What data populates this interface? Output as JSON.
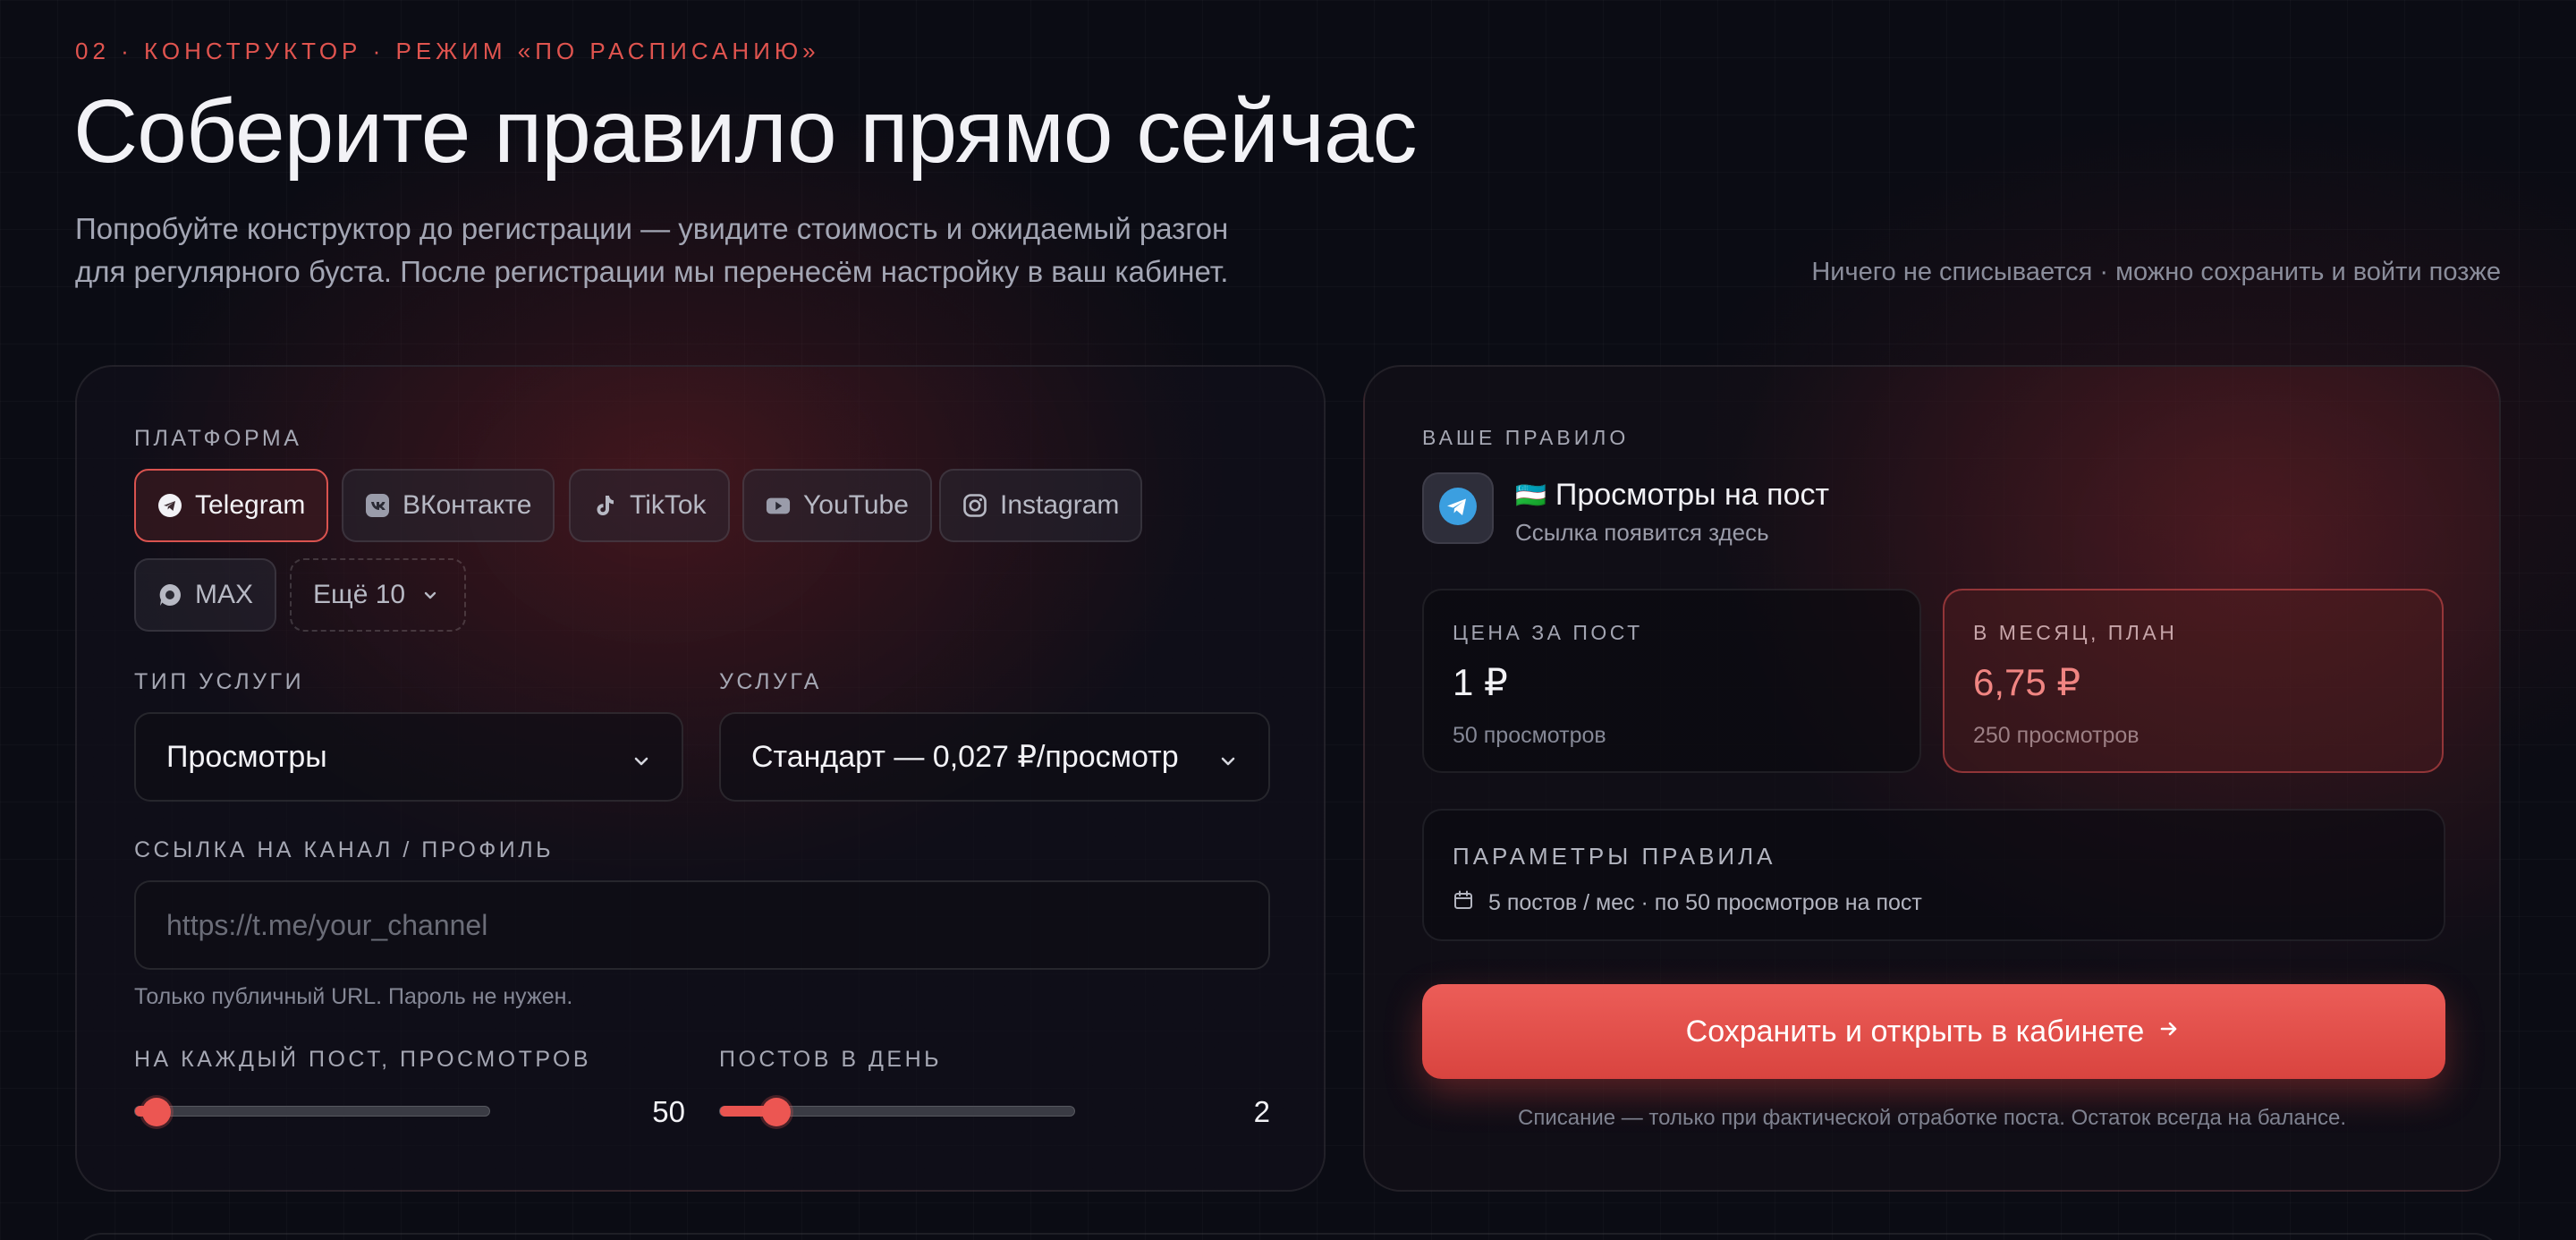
{
  "header": {
    "eyebrow": "02 · КОНСТРУКТОР · РЕЖИМ «ПО РАСПИСАНИЮ»",
    "title": "Соберите правило прямо сейчас",
    "lead_line1": "Попробуйте конструктор до регистрации — увидите стоимость и ожидаемый разгон",
    "lead_line2": "для регулярного буста. После регистрации мы перенесём настройку в ваш кабинет.",
    "note": "Ничего не списывается · можно сохранить и войти позже"
  },
  "builder": {
    "platform_label": "ПЛАТФОРМА",
    "platforms": [
      {
        "label": "Telegram",
        "icon": "telegram-icon",
        "active": true
      },
      {
        "label": "ВКонтакте",
        "icon": "vk-icon",
        "active": false
      },
      {
        "label": "TikTok",
        "icon": "tiktok-icon",
        "active": false
      },
      {
        "label": "YouTube",
        "icon": "youtube-icon",
        "active": false
      },
      {
        "label": "Instagram",
        "icon": "instagram-icon",
        "active": false
      },
      {
        "label": "MAX",
        "icon": "max-icon",
        "active": false
      }
    ],
    "more_label": "Ещё 10",
    "service_type_label": "ТИП УСЛУГИ",
    "service_type_value": "Просмотры",
    "service_label": "УСЛУГА",
    "service_value": "Стандарт — 0,027 ₽/просмотр",
    "link_label": "ССЫЛКА НА КАНАЛ / ПРОФИЛЬ",
    "link_value": "",
    "link_placeholder": "https://t.me/your_channel",
    "link_hint": "Только публичный URL. Пароль не нужен.",
    "per_post_label": "НА КАЖДЫЙ ПОСТ, ПРОСМОТРОВ",
    "per_post_value": "50",
    "per_post_fraction": 0.04,
    "posts_per_day_label": "ПОСТОВ В ДЕНЬ",
    "posts_per_day_value": "2",
    "posts_per_day_fraction": 0.14
  },
  "rule": {
    "label": "ВАШЕ ПРАВИЛО",
    "icon": "telegram-icon",
    "flag": "🇺🇿",
    "title": "Просмотры на пост",
    "subtitle": "Ссылка появится здесь",
    "price_label": "ЦЕНА ЗА ПОСТ",
    "price_value": "1 ₽",
    "price_sub": "50 просмотров",
    "month_label": "В МЕСЯЦ, ПЛАН",
    "month_value": "6,75 ₽",
    "month_sub": "250 просмотров",
    "params_label": "ПАРАМЕТРЫ ПРАВИЛА",
    "params_text": "5 постов / мес · по 50 просмотров на пост",
    "cta_label": "Сохранить и открыть в кабинете",
    "footnote": "Списание — только при фактической отработке поста. Остаток всегда на балансе."
  },
  "colors": {
    "accent": "#e85450",
    "background": "#0b0c14"
  }
}
